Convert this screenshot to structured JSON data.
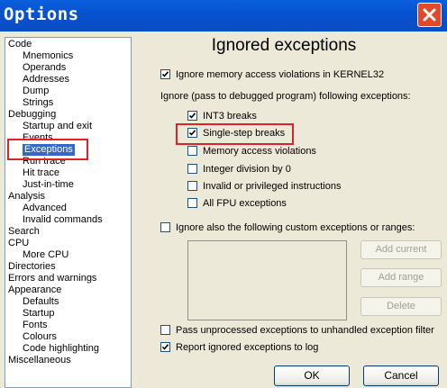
{
  "window": {
    "title": "Options"
  },
  "tree": {
    "items": [
      {
        "label": "Code",
        "level": 0
      },
      {
        "label": "Mnemonics",
        "level": 1
      },
      {
        "label": "Operands",
        "level": 1
      },
      {
        "label": "Addresses",
        "level": 1
      },
      {
        "label": "Dump",
        "level": 1
      },
      {
        "label": "Strings",
        "level": 1
      },
      {
        "label": "Debugging",
        "level": 0
      },
      {
        "label": "Startup and exit",
        "level": 1
      },
      {
        "label": "Events",
        "level": 1
      },
      {
        "label": "Exceptions",
        "level": 1,
        "selected": true
      },
      {
        "label": "Run trace",
        "level": 1
      },
      {
        "label": "Hit trace",
        "level": 1
      },
      {
        "label": "Just-in-time",
        "level": 1
      },
      {
        "label": "Analysis",
        "level": 0
      },
      {
        "label": "Advanced",
        "level": 1
      },
      {
        "label": "Invalid commands",
        "level": 1
      },
      {
        "label": "Search",
        "level": 0
      },
      {
        "label": "CPU",
        "level": 0
      },
      {
        "label": "More CPU",
        "level": 1
      },
      {
        "label": "Directories",
        "level": 0
      },
      {
        "label": "Errors and warnings",
        "level": 0
      },
      {
        "label": "Appearance",
        "level": 0
      },
      {
        "label": "Defaults",
        "level": 1
      },
      {
        "label": "Startup",
        "level": 1
      },
      {
        "label": "Fonts",
        "level": 1
      },
      {
        "label": "Colours",
        "level": 1
      },
      {
        "label": "Code highlighting",
        "level": 1
      },
      {
        "label": "Miscellaneous",
        "level": 0
      }
    ]
  },
  "panel": {
    "heading": "Ignored exceptions",
    "ignore_memory": {
      "label": "Ignore memory access violations in KERNEL32",
      "checked": true
    },
    "group_label": "Ignore (pass to debugged program) following exceptions:",
    "exceptions": [
      {
        "label": "INT3 breaks",
        "checked": true
      },
      {
        "label": "Single-step breaks",
        "checked": true
      },
      {
        "label": "Memory access violations",
        "checked": false
      },
      {
        "label": "Integer division by 0",
        "checked": false
      },
      {
        "label": "Invalid or privileged instructions",
        "checked": false
      },
      {
        "label": "All FPU exceptions",
        "checked": false
      }
    ],
    "custom": {
      "label": "Ignore also the following custom exceptions or ranges:",
      "checked": false
    },
    "buttons": {
      "add_current": "Add current",
      "add_range": "Add range",
      "delete": "Delete"
    },
    "pass_unprocessed": {
      "label": "Pass unprocessed exceptions to unhandled exception filter",
      "checked": false
    },
    "report_ignored": {
      "label": "Report ignored exceptions to log",
      "checked": true
    }
  },
  "footer": {
    "ok": "OK",
    "cancel": "Cancel"
  },
  "colors": {
    "titlebar": "#0a5fde",
    "selection": "#316ac5",
    "highlight_box": "#e0202a",
    "dialog_bg": "#ece9d8"
  }
}
